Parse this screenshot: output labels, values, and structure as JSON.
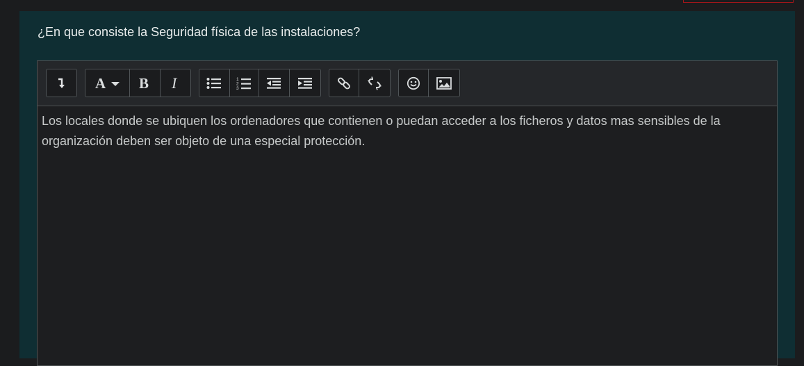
{
  "question": {
    "text": "¿En que consiste la Seguridad física de las instalaciones?"
  },
  "toolbar": {
    "groups": [
      {
        "buttons": [
          {
            "icon": "expand-toolbar-icon"
          }
        ]
      },
      {
        "buttons": [
          {
            "icon": "font-style-icon"
          },
          {
            "icon": "bold-icon"
          },
          {
            "icon": "italic-icon"
          }
        ]
      },
      {
        "buttons": [
          {
            "icon": "unordered-list-icon"
          },
          {
            "icon": "ordered-list-icon"
          },
          {
            "icon": "outdent-icon"
          },
          {
            "icon": "indent-icon"
          }
        ]
      },
      {
        "buttons": [
          {
            "icon": "link-icon"
          },
          {
            "icon": "unlink-icon"
          }
        ]
      },
      {
        "buttons": [
          {
            "icon": "emoji-icon"
          },
          {
            "icon": "image-icon"
          }
        ]
      }
    ]
  },
  "editor": {
    "content_line1": "Los locales donde se ubiquen los ordenadores que contienen o puedan acceder a los ficheros y datos mas sensibles de la",
    "content_line2": "organización deben ser objeto de una especial protección."
  },
  "colors": {
    "page_bg": "#1b1c1e",
    "panel_bg": "#0f2e33",
    "editor_bg": "#1d1e20",
    "toolbar_bg": "#25272a",
    "accent_red": "#a4161a"
  }
}
